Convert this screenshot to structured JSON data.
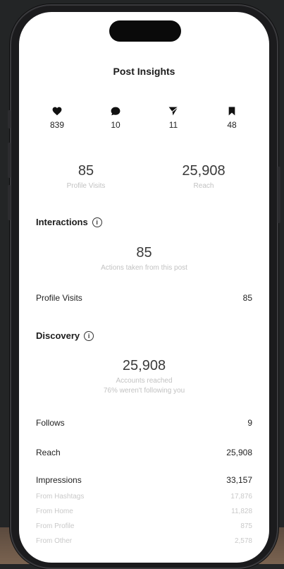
{
  "header": {
    "title": "Post Insights"
  },
  "stats": [
    {
      "icon": "heart-icon",
      "value": "839"
    },
    {
      "icon": "comment-icon",
      "value": "10"
    },
    {
      "icon": "share-icon",
      "value": "11"
    },
    {
      "icon": "bookmark-icon",
      "value": "48"
    }
  ],
  "summary": {
    "profile_visits": {
      "value": "85",
      "label": "Profile Visits"
    },
    "reach": {
      "value": "25,908",
      "label": "Reach"
    }
  },
  "interactions": {
    "heading": "Interactions",
    "total": "85",
    "caption": "Actions taken from this post",
    "rows": [
      {
        "label": "Profile Visits",
        "value": "85"
      }
    ]
  },
  "discovery": {
    "heading": "Discovery",
    "total": "25,908",
    "caption": "Accounts reached",
    "caption2": "76% weren't following you",
    "follows": {
      "label": "Follows",
      "value": "9"
    },
    "reach": {
      "label": "Reach",
      "value": "25,908"
    },
    "impressions": {
      "label": "Impressions",
      "value": "33,157"
    },
    "breakdown": [
      {
        "label": "From Hashtags",
        "value": "17,876"
      },
      {
        "label": "From Home",
        "value": "11,828"
      },
      {
        "label": "From Profile",
        "value": "875"
      },
      {
        "label": "From Other",
        "value": "2,578"
      }
    ]
  },
  "colors": {
    "background": "#232526",
    "screen": "#ffffff",
    "muted_text": "#c2c2c2"
  }
}
